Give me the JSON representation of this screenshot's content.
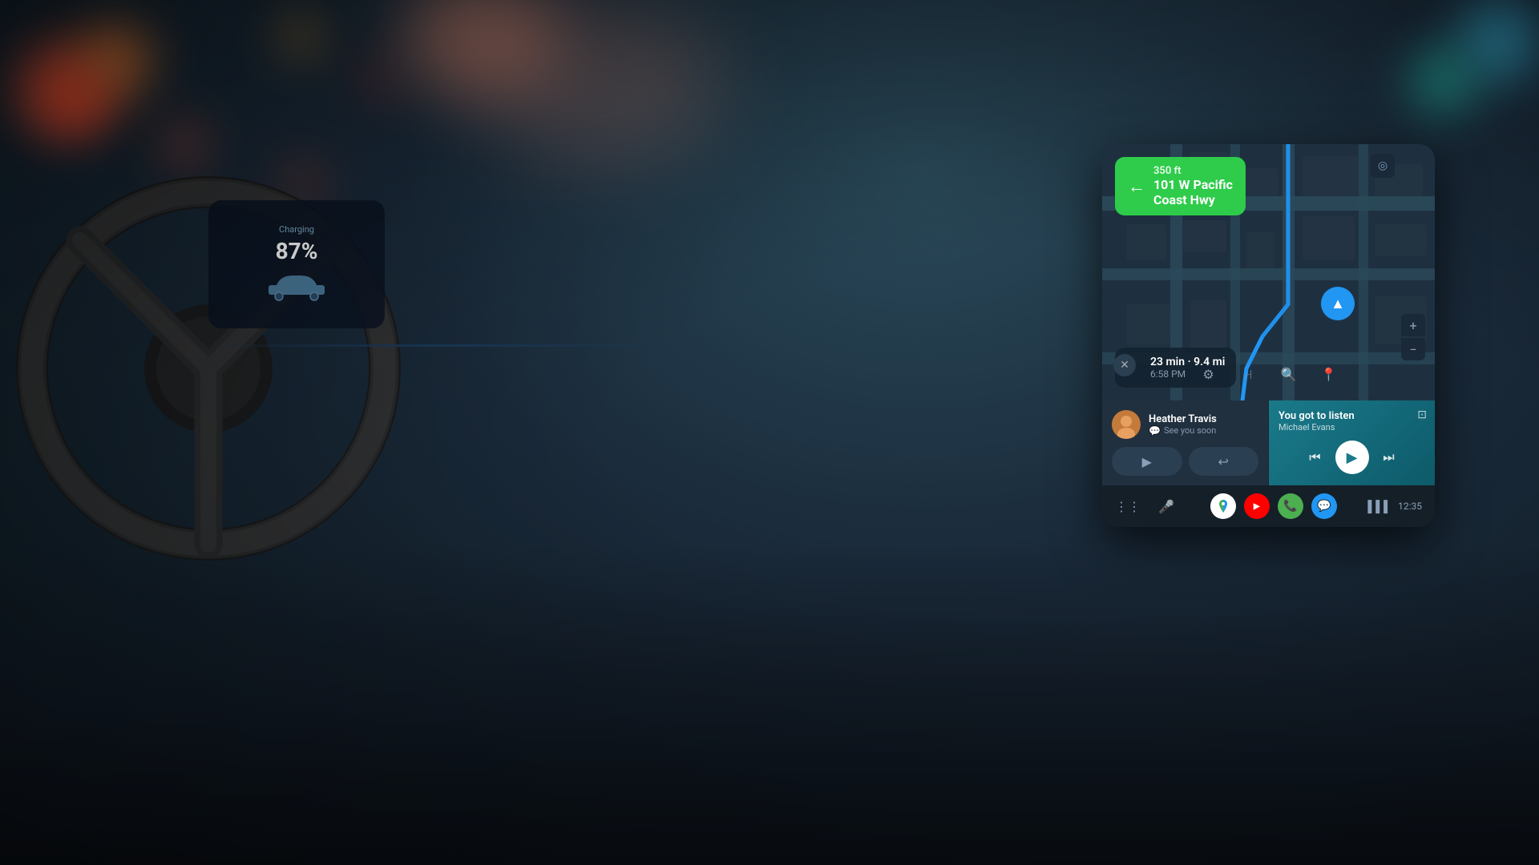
{
  "background": {
    "colors": {
      "sky": "#2a5060",
      "dark": "#0d1a22"
    }
  },
  "dashboard": {
    "charging_label": "Charging",
    "battery_percent": "87%"
  },
  "map": {
    "turn": {
      "distance": "350 ft",
      "street": "101 W Pacific\nCoast Hwy",
      "direction": "left"
    },
    "eta": {
      "duration": "23 min · 9.4 mi",
      "arrival": "6:58 PM"
    }
  },
  "message": {
    "contact_name": "Heather Travis",
    "preview": "See you soon",
    "icon": "💬",
    "actions": {
      "play": "▶",
      "reply": "↩"
    }
  },
  "music": {
    "song_title": "You got to listen",
    "artist": "Michael Evans",
    "controls": {
      "prev": "⏮",
      "play": "▶",
      "next": "⏭"
    }
  },
  "nav_bar": {
    "apps": [
      {
        "name": "Maps",
        "class": "app-maps"
      },
      {
        "name": "YouTube Music",
        "class": "app-youtube"
      },
      {
        "name": "Phone",
        "class": "app-phone"
      },
      {
        "name": "Messages",
        "class": "app-messages"
      }
    ],
    "time": "12:35",
    "signal": "▌▌▌"
  },
  "tools": {
    "settings": "⚙",
    "routes": "⑂",
    "search": "🔍",
    "pin": "📍",
    "zoom_in": "+",
    "zoom_out": "−",
    "location": "◎",
    "grid": "⋮⋮",
    "mic": "🎤",
    "cast": "⊡"
  }
}
